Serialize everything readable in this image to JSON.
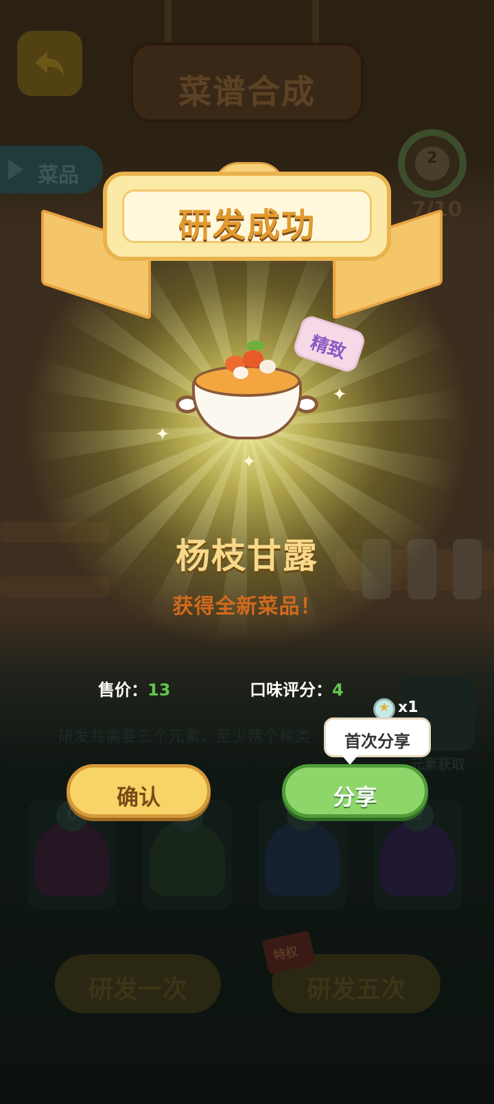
{
  "screen": {
    "title": "菜谱合成",
    "dish_tab_label": "菜品",
    "progress": "7/10",
    "progress_badge": "2",
    "hint": "研发共需要三个元素，至少两个种类",
    "element_label": "元素获取",
    "slot_counts": [
      "0",
      "0",
      "0",
      "0"
    ],
    "develop_once": "研发一次",
    "develop_five": "研发五次",
    "privilege_badge": "特权"
  },
  "dialog": {
    "banner_title": "研发成功",
    "quality_tag": "精致",
    "dish_name": "杨枝甘露",
    "subtitle": "获得全新菜品！",
    "price_label": "售价：",
    "price_value": "13",
    "taste_label": "口味评分：",
    "taste_value": "4",
    "confirm_label": "确认",
    "share_label": "分享",
    "tooltip": "首次分享",
    "reward_icon": "star-coin-icon",
    "reward_qty": "x1"
  },
  "colors": {
    "banner_gold": "#e29a2e",
    "dish_name": "#f8d98a",
    "subtitle": "#d26a1e",
    "stat_value": "#62c64d",
    "confirm_bg": "#f8d468",
    "share_bg": "#8fd66a",
    "tag_text": "#8c5ac4"
  }
}
